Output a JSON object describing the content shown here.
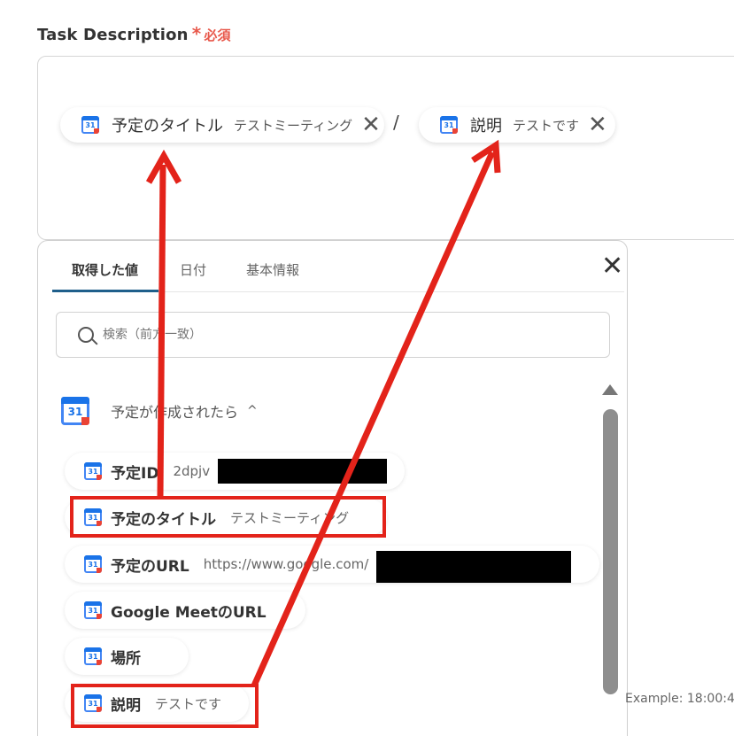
{
  "field": {
    "label": "Task Description",
    "required_star": "*",
    "required_text": "必須"
  },
  "selected_chips": [
    {
      "label": "予定のタイトル",
      "value": "テストミーティング",
      "remove": "✕"
    },
    {
      "label": "説明",
      "value": "テストです",
      "remove": "✕"
    }
  ],
  "separator": "/",
  "panel": {
    "tabs": [
      "取得した値",
      "日付",
      "基本情報"
    ],
    "active_tab": 0,
    "close": "✕",
    "search_placeholder": "検索（前方一致）",
    "section_title": "予定が作成されたら",
    "section_chevron": "^",
    "items": [
      {
        "label": "予定ID",
        "value": "2dpjv"
      },
      {
        "label": "予定のタイトル",
        "value": "テストミーティング"
      },
      {
        "label": "予定のURL",
        "value": "https://www.google.com/"
      },
      {
        "label": "Google MeetのURL",
        "value": ""
      },
      {
        "label": "場所",
        "value": ""
      },
      {
        "label": "説明",
        "value": "テストです"
      }
    ]
  },
  "example_hint": "Example: 18:00:4",
  "calendar_icon_day": "31",
  "icons": {
    "calendar": "google-calendar-icon",
    "search": "search-icon",
    "close": "close-icon",
    "remove": "remove-icon",
    "chevron": "chevron-up-icon"
  },
  "colors": {
    "annotation_red": "#e3231a",
    "required_red": "#e8584b",
    "tab_underline": "#1f5f8b"
  }
}
